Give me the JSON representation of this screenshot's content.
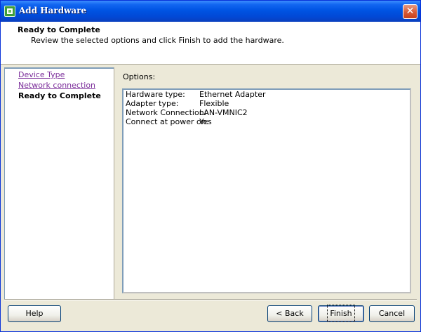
{
  "window": {
    "title": "Add Hardware",
    "close_symbol": "✕"
  },
  "header": {
    "title": "Ready to Complete",
    "description": "Review the selected options and click Finish to add the hardware."
  },
  "steps": [
    {
      "label": "Device Type",
      "state": "link"
    },
    {
      "label": "Network connection",
      "state": "link"
    },
    {
      "label": "Ready to Complete",
      "state": "current"
    }
  ],
  "options": {
    "label": "Options:",
    "rows": [
      {
        "key": "Hardware type:",
        "value": "Ethernet Adapter"
      },
      {
        "key": "Adapter type:",
        "value": "Flexible"
      },
      {
        "key": "Network Connection:",
        "value": "LAN-VMNIC2"
      },
      {
        "key": "Connect at power on:",
        "value": "Yes"
      }
    ]
  },
  "buttons": {
    "help": "Help",
    "back": "< Back",
    "finish": "Finish",
    "cancel": "Cancel"
  },
  "icons": {
    "app": "vm-hardware-icon",
    "close": "close-icon"
  },
  "colors": {
    "titlebar": "#0054e3",
    "link": "#7b2d9a",
    "close": "#d85a36"
  }
}
